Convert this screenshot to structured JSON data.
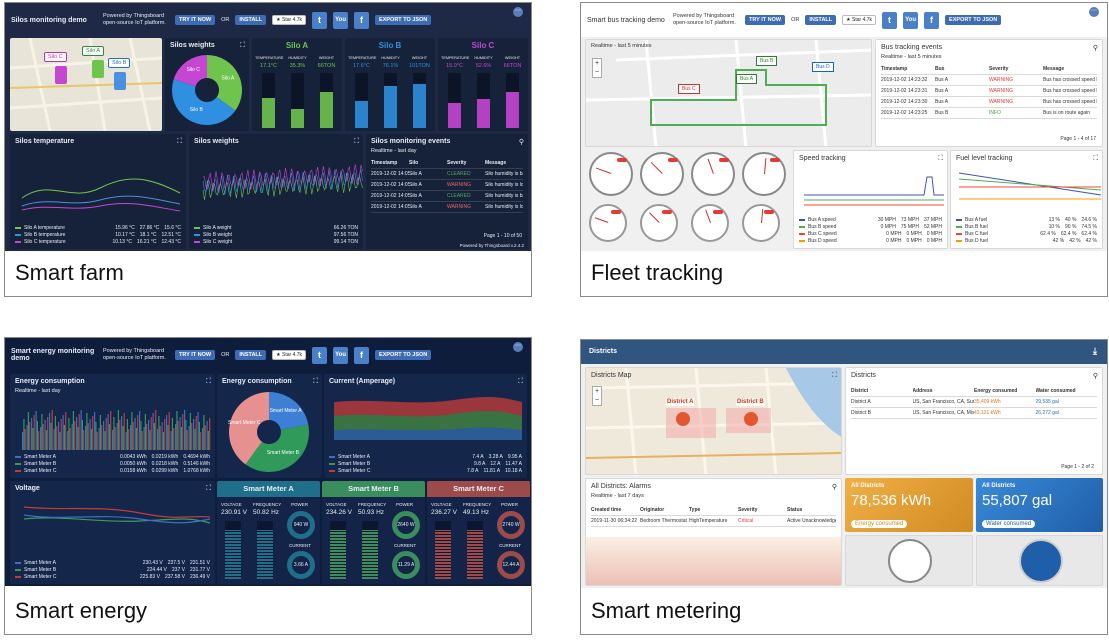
{
  "captions": [
    "Smart farm",
    "Fleet tracking",
    "Smart energy",
    "Smart metering"
  ],
  "common": {
    "powered": "Powered by Thingsboard open-source IoT platform.",
    "try": "TRY IT NOW",
    "or": "OR",
    "install": "INSTALL",
    "star": "★ Star  4.7k",
    "export": "EXPORT TO JSON",
    "socials": [
      "t",
      "You",
      "f"
    ],
    "footer": "Powered by Thingsboard v.2.4.2"
  },
  "farm": {
    "title": "Silos monitoring demo",
    "map_labels": [
      "Silo C",
      "Silo A",
      "Silo B"
    ],
    "weights_title": "Silos weights",
    "pie_labels": [
      "Silo A",
      "Silo B",
      "Silo C"
    ],
    "pie_values": [
      35,
      45,
      20
    ],
    "silos": [
      {
        "name": "Silo A",
        "cols": [
          "TEMPERATURE",
          "HUMIDITY",
          "WEIGHT"
        ],
        "vals": [
          "17.1°C",
          "35.3%",
          "66TON"
        ],
        "levels": [
          0.55,
          0.35,
          0.66
        ]
      },
      {
        "name": "Silo B",
        "cols": [
          "TEMPERATURE",
          "HUMIDITY",
          "WEIGHT"
        ],
        "vals": [
          "17.6°C",
          "76.1%",
          "101TON"
        ],
        "levels": [
          0.5,
          0.76,
          0.8
        ]
      },
      {
        "name": "Silo C",
        "cols": [
          "TEMPERATURE",
          "HUMIDITY",
          "WEIGHT"
        ],
        "vals": [
          "15.0°C",
          "52.6%",
          "66TON"
        ],
        "levels": [
          0.45,
          0.53,
          0.66
        ]
      }
    ],
    "temp_title": "Silos temperature",
    "temp_legend": [
      {
        "name": "Silo A temperature",
        "vals": [
          "15.96 °C",
          "27.86 °C",
          "15.6 °C"
        ]
      },
      {
        "name": "Silo B temperature",
        "vals": [
          "10.17 °C",
          "18.1 °C",
          "12.51 °C"
        ]
      },
      {
        "name": "Silo C temperature",
        "vals": [
          "10.13 °C",
          "16.21 °C",
          "12.43 °C"
        ]
      }
    ],
    "temp_cols": [
      "min",
      "max",
      "avg"
    ],
    "w_title": "Silos weights",
    "w_legend": [
      {
        "name": "Silo A weight",
        "val": "66.26 TON"
      },
      {
        "name": "Silo B weight",
        "val": "97.56 TON"
      },
      {
        "name": "Silo C weight",
        "val": "99.14 TON"
      }
    ],
    "events_title": "Silos monitoring events",
    "events_sub": "Realtime - last day",
    "events_cols": [
      "Timestamp",
      "Silo",
      "Severity",
      "Message"
    ],
    "events": [
      [
        "2019-12-02 14:05:46",
        "Silo A",
        "CLEARED",
        "Silo humidity is back to normal!"
      ],
      [
        "2019-12-02 14:05:45",
        "Silo A",
        "WARNING",
        "Silo humidity is low!"
      ],
      [
        "2019-12-02 14:05:44",
        "Silo A",
        "CLEARED",
        "Silo humidity is back to normal!"
      ],
      [
        "2019-12-02 14:05:44",
        "Silo A",
        "WARNING",
        "Silo humidity is low!"
      ]
    ],
    "page": "Page  1 - 10 of 50"
  },
  "fleet": {
    "title": "Smart bus tracking demo",
    "map_sub": "Realtime - last 5 minutes",
    "buses": [
      "Bus A",
      "Bus B",
      "Bus C",
      "Bus D"
    ],
    "events_title": "Bus tracking events",
    "events_sub": "Realtime - last 5 minutes",
    "events_cols": [
      "Timestamp",
      "Bus",
      "Severity",
      "Message"
    ],
    "events": [
      [
        "2019-12-02 14:23:32",
        "Bus A",
        "WARNING",
        "Bus has crossed speed limit!"
      ],
      [
        "2019-12-02 14:23:31",
        "Bus A",
        "WARNING",
        "Bus has crossed speed limit!"
      ],
      [
        "2019-12-02 14:23:30",
        "Bus A",
        "WARNING",
        "Bus has crossed speed limit!"
      ],
      [
        "2019-12-02 14:23:25",
        "Bus B",
        "INFO",
        "Bus is on route again"
      ]
    ],
    "page": "Page  1 - 4 of 17",
    "speed_title": "Speed tracking",
    "speed_legend": [
      {
        "name": "Bus A speed",
        "vals": [
          "30 MPH",
          "73 MPH",
          "37 MPH"
        ]
      },
      {
        "name": "Bus B speed",
        "vals": [
          "0 MPH",
          "75 MPH",
          "52 MPH"
        ]
      },
      {
        "name": "Bus C speed",
        "vals": [
          "0 MPH",
          "0 MPH",
          "0 MPH"
        ]
      },
      {
        "name": "Bus D speed",
        "vals": [
          "0 MPH",
          "0 MPH",
          "0 MPH"
        ]
      }
    ],
    "fuel_title": "Fuel level tracking",
    "fuel_legend": [
      {
        "name": "Bus A fuel",
        "vals": [
          "13 %",
          "40 %",
          "24.6 %"
        ]
      },
      {
        "name": "Bus B fuel",
        "vals": [
          "10 %",
          "90 %",
          "74.5 %"
        ]
      },
      {
        "name": "Bus C fuel",
        "vals": [
          "62.4 %",
          "62.4 %",
          "62.4 %"
        ]
      },
      {
        "name": "Bus D fuel",
        "vals": [
          "42 %",
          "42 %",
          "42 %"
        ]
      }
    ]
  },
  "energy": {
    "title": "Smart energy monitoring demo",
    "cons_title": "Energy consumption",
    "cons_sub": "Realtime - last day",
    "cons_legend": [
      {
        "name": "Smart Meter A",
        "vals": [
          "0.0043 kWh",
          "0.0219 kWh",
          "0.4694 kWh"
        ]
      },
      {
        "name": "Smart Meter B",
        "vals": [
          "0.0050 kWh",
          "0.0218 kWh",
          "0.5146 kWh"
        ]
      },
      {
        "name": "Smart Meter C",
        "vals": [
          "0.0158 kWh",
          "0.0299 kWh",
          "1.0768 kWh"
        ]
      }
    ],
    "pie_title": "Energy consumption",
    "pie_labels": [
      "Smart Meter A",
      "Smart Meter B",
      "Smart Meter C"
    ],
    "pie_values": [
      22,
      38,
      40
    ],
    "cur_title": "Current (Amperage)",
    "cur_legend": [
      {
        "name": "Smart Meter A",
        "vals": [
          "7.4 A",
          "3.28 A",
          "9.95 A"
        ]
      },
      {
        "name": "Smart Meter B",
        "vals": [
          "9.8 A",
          "12 A",
          "11.47 A"
        ]
      },
      {
        "name": "Smart Meter C",
        "vals": [
          "7.8 A",
          "11.81 A",
          "10.18 A"
        ]
      }
    ],
    "volt_title": "Voltage",
    "volt_legend": [
      {
        "name": "Smart Meter A",
        "vals": [
          "230.43 V",
          "237.5 V",
          "231.51 V"
        ]
      },
      {
        "name": "Smart Meter B",
        "vals": [
          "224.44 V",
          "237 V",
          "231.77 V"
        ]
      },
      {
        "name": "Smart Meter C",
        "vals": [
          "225.83 V",
          "237.58 V",
          "236.49 V"
        ]
      }
    ],
    "meters": [
      {
        "name": "Smart Meter A",
        "voltage": "230.91 V",
        "freq": "50.82 Hz",
        "power": "940 W",
        "current": "3.66 A",
        "color": "#1f6f8b"
      },
      {
        "name": "Smart Meter B",
        "voltage": "234.26 V",
        "freq": "50.93 Hz",
        "power": "2640 W",
        "current": "11.29 A",
        "color": "#3a8d5c"
      },
      {
        "name": "Smart Meter C",
        "voltage": "236.27 V",
        "freq": "49.13 Hz",
        "power": "2740 W",
        "current": "12.44 A",
        "color": "#9c4a4a"
      }
    ],
    "labels": {
      "voltage": "VOLTAGE",
      "freq": "FREQUENCY",
      "power": "POWER",
      "current": "CURRENT"
    }
  },
  "metering": {
    "title": "Districts",
    "map_title": "Districts Map",
    "map_labels": [
      "District A",
      "District B"
    ],
    "table_title": "Districts",
    "table_cols": [
      "District",
      "Address",
      "Energy consumed",
      "Water consumed"
    ],
    "rows": [
      [
        "District A",
        "US, San Francisco, CA, Sunset District",
        "35,409 kWh",
        "29,535 gal"
      ],
      [
        "District B",
        "US, San Francisco, CA, Mission District",
        "43,131 kWh",
        "26,272 gal"
      ]
    ],
    "page": "Page  1 - 2 of 2",
    "alarms_title": "All Districts: Alarms",
    "alarms_sub": "Realtime - last 7 days",
    "alarms_cols": [
      "Created time",
      "Originator",
      "Type",
      "Severity",
      "Status"
    ],
    "alarm": [
      "2019-11-30 06:34:22",
      "Bedroom Thermostat",
      "HighTemperature",
      "Critical",
      "Active Unacknowledged"
    ],
    "energy_label": "All Districts",
    "energy_value": "78,536 kWh",
    "energy_caption": "Energy consumed",
    "water_label": "All Districts",
    "water_value": "55,807 gal",
    "water_caption": "Water consumed"
  }
}
